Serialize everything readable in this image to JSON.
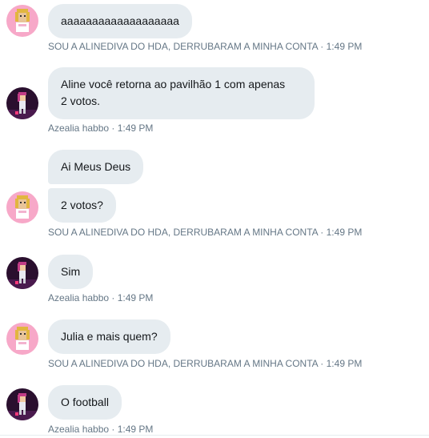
{
  "conversation": {
    "messages": [
      {
        "sender": "aline",
        "text": "aaaaaaaaaaaaaaaaaaa"
      },
      {
        "sender": "azealia",
        "line1": "Aline você retorna ao pavilhão 1 com apenas",
        "line2": "2 votos."
      },
      {
        "sender": "aline",
        "text": "Ai Meus Deus"
      },
      {
        "sender": "aline",
        "text": "2 votos?"
      },
      {
        "sender": "azealia",
        "text": "Sim"
      },
      {
        "sender": "aline",
        "text": "Julia e mais quem?"
      },
      {
        "sender": "azealia",
        "text": "O football"
      }
    ],
    "meta": {
      "aline": "SOU A ALINEDIVA DO HDA, DERRUBARAM A MINHA CONTA · 1:49 PM",
      "azealia": "Azealia habbo · 1:49 PM"
    }
  },
  "colors": {
    "bubble_bg": "#e6ecf0",
    "text": "#14171a",
    "meta": "#657786",
    "aline_avatar_bg": "#f7a8c8",
    "azealia_avatar_bg": "#2a0f2e"
  }
}
